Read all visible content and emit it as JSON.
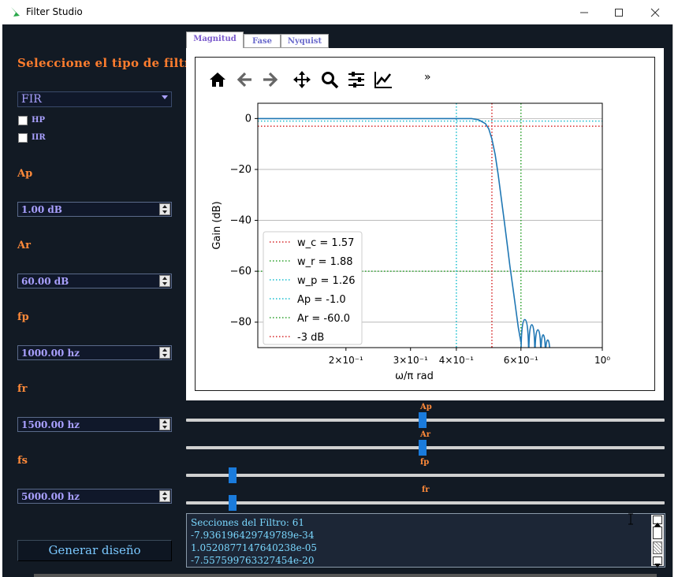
{
  "window": {
    "title": "Filter Studio"
  },
  "sidebar": {
    "heading": "Seleccione el tipo de filtro",
    "filter_type": "FIR",
    "checkboxes": [
      {
        "label": "HP",
        "checked": false
      },
      {
        "label": "IIR",
        "checked": false
      }
    ],
    "params": [
      {
        "label": "Ap",
        "value": "1.00 dB"
      },
      {
        "label": "Ar",
        "value": "60.00 dB"
      },
      {
        "label": "fp",
        "value": "1000.00 hz"
      },
      {
        "label": "fr",
        "value": "1500.00 hz"
      },
      {
        "label": "fs",
        "value": "5000.00 hz"
      }
    ],
    "generate_label": "Generar diseño"
  },
  "tabs": [
    {
      "label": "Magnitud",
      "active": true
    },
    {
      "label": "Fase",
      "active": false
    },
    {
      "label": "Nyquist",
      "active": false
    }
  ],
  "toolbar": {
    "icons": [
      "home-icon",
      "back-icon",
      "forward-icon",
      "pan-icon",
      "zoom-icon",
      "configure-icon",
      "edit-axis-icon"
    ],
    "more": "»"
  },
  "sliders": [
    {
      "label": "Ap",
      "value_fraction": 0.49
    },
    {
      "label": "Ar",
      "value_fraction": 0.49
    },
    {
      "label": "fp",
      "value_fraction": 0.09
    },
    {
      "label": "fr",
      "value_fraction": 0.09
    }
  ],
  "output": {
    "lines": [
      "Secciones del Filtro: 61",
      "-7.936196429749789e-34",
      "1.0520877147640238e-05",
      "-7.557599763327454e-20"
    ]
  },
  "colors": {
    "background": "#121a24",
    "heading": "#ff7d2e",
    "label": "#ff8a3a",
    "value_text": "#a9a0ff",
    "slider_handle": "#1a7bdc",
    "output_text": "#7ad8ff",
    "curve": "#1f77b4"
  },
  "chart_data": {
    "type": "line",
    "xlabel": "ω/π rad",
    "ylabel": "Gain (dB)",
    "xscale": "log",
    "xlim": [
      0.115,
      1.0
    ],
    "ylim": [
      -90,
      6
    ],
    "x_tick_labels": [
      "2×10⁻¹",
      "3×10⁻¹",
      "4×10⁻¹",
      "6×10⁻¹",
      "10⁰"
    ],
    "x_ticks": [
      0.2,
      0.3,
      0.4,
      0.6,
      1.0
    ],
    "y_ticks": [
      0,
      -20,
      -40,
      -60,
      -80
    ],
    "y_tick_labels": [
      "0",
      "−20",
      "−40",
      "−60",
      "−80"
    ],
    "grid": "y",
    "legend": "lower-left",
    "legend_entries": [
      {
        "label": "w_c = 1.57",
        "color": "#d62728"
      },
      {
        "label": "w_r = 1.88",
        "color": "#2ca02c"
      },
      {
        "label": "w_p = 1.26",
        "color": "#17becf"
      },
      {
        "label": "Ap =  -1.0",
        "color": "#17becf"
      },
      {
        "label": "Ar =  -60.0",
        "color": "#2ca02c"
      },
      {
        "label": "-3 dB",
        "color": "#d62728"
      }
    ],
    "vlines": [
      {
        "x": 0.4,
        "color": "#17becf"
      },
      {
        "x": 0.5,
        "color": "#d62728"
      },
      {
        "x": 0.6,
        "color": "#2ca02c"
      }
    ],
    "hlines": [
      {
        "y": -1,
        "color": "#17becf"
      },
      {
        "y": -3,
        "color": "#d62728"
      },
      {
        "y": -60,
        "color": "#2ca02c"
      }
    ],
    "series": [
      {
        "values_x": [
          0.115,
          0.2,
          0.3,
          0.4,
          0.44,
          0.46,
          0.48,
          0.49,
          0.5,
          0.51,
          0.52,
          0.53,
          0.54,
          0.55,
          0.56,
          0.57,
          0.58,
          0.59,
          0.6
        ],
        "values_y": [
          0,
          0,
          0,
          0,
          0,
          -0.5,
          -2,
          -4,
          -8,
          -14,
          -22,
          -31,
          -40,
          -49,
          -58,
          -66,
          -74,
          -82,
          -88
        ]
      }
    ],
    "ripples": [
      {
        "x0": 0.6,
        "x1": 0.63,
        "peak": -79
      },
      {
        "x0": 0.63,
        "x1": 0.655,
        "peak": -81
      },
      {
        "x0": 0.655,
        "x1": 0.68,
        "peak": -83
      },
      {
        "x0": 0.68,
        "x1": 0.7,
        "peak": -85
      },
      {
        "x0": 0.7,
        "x1": 0.72,
        "peak": -87
      }
    ]
  }
}
